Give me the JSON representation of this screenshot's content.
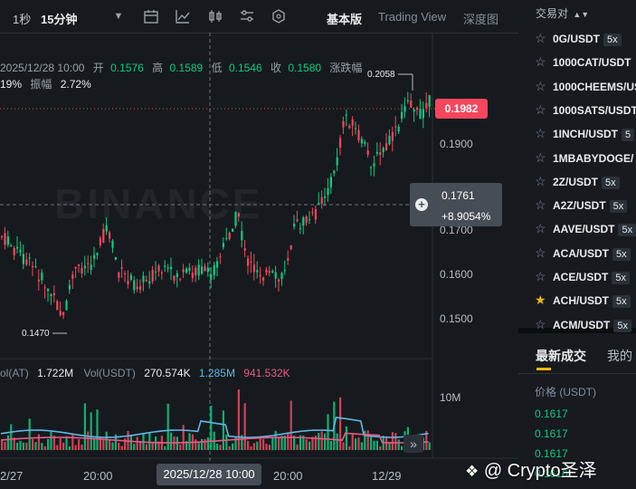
{
  "toolbar": {
    "intervals": [
      {
        "label": "1秒",
        "active": false
      },
      {
        "label": "15分钟",
        "active": true
      }
    ],
    "views": [
      {
        "label": "基本版",
        "active": true
      },
      {
        "label": "Trading View",
        "active": false
      },
      {
        "label": "深度图",
        "active": false
      }
    ]
  },
  "ohlc": {
    "datetime": "2025/12/28 10:00",
    "open_label": "开",
    "open": "0.1576",
    "high_label": "高",
    "high": "0.1589",
    "low_label": "低",
    "low": "0.1546",
    "close_label": "收",
    "close": "0.1580",
    "change_label": "涨跌幅",
    "change_pct": "19%",
    "amp_label": "振幅",
    "amp": "2.72%"
  },
  "price_axis": [
    "0.1900",
    "0.1700",
    "0.1600",
    "0.1500"
  ],
  "current_price": "0.1982",
  "crosshair": {
    "price": "0.1761",
    "change": "+8.9054%"
  },
  "high_marker": "0.2058",
  "low_marker": "0.1470",
  "watermark": "BINANCE",
  "volume": {
    "vol_at_label": "ol(AT)",
    "vol_at": "1.722M",
    "vol_usdt_label": "Vol(USDT)",
    "vol_usdt": "270.574K",
    "ma1": "1.285M",
    "ma2": "941.532K",
    "axis_label": "10M",
    "colors": {
      "ma1": "#5fb8e6",
      "ma2": "#e85a8a"
    }
  },
  "time_axis": {
    "labels": [
      "2/27",
      "20:00",
      "20:00",
      "12/29"
    ],
    "highlight": "2025/12/28 10:00"
  },
  "pairs": {
    "header": "交易对",
    "items": [
      {
        "symbol": "0G/USDT",
        "leverage": "5x",
        "fav": false
      },
      {
        "symbol": "1000CAT/USDT",
        "leverage": "",
        "fav": false
      },
      {
        "symbol": "1000CHEEMS/USDT",
        "leverage": "",
        "fav": false
      },
      {
        "symbol": "1000SATS/USDT",
        "leverage": "",
        "fav": false
      },
      {
        "symbol": "1INCH/USDT",
        "leverage": "5",
        "fav": false
      },
      {
        "symbol": "1MBABYDOGE/",
        "leverage": "",
        "fav": false
      },
      {
        "symbol": "2Z/USDT",
        "leverage": "5x",
        "fav": false
      },
      {
        "symbol": "A2Z/USDT",
        "leverage": "5x",
        "fav": false
      },
      {
        "symbol": "AAVE/USDT",
        "leverage": "5x",
        "fav": false
      },
      {
        "symbol": "ACA/USDT",
        "leverage": "5x",
        "fav": false
      },
      {
        "symbol": "ACE/USDT",
        "leverage": "5x",
        "fav": false
      },
      {
        "symbol": "ACH/USDT",
        "leverage": "5x",
        "fav": true
      },
      {
        "symbol": "ACM/USDT",
        "leverage": "5x",
        "fav": false
      }
    ]
  },
  "trades": {
    "tab_active": "最新成交",
    "tab_inactive": "我的",
    "price_col": "价格 (USDT)",
    "prices": [
      "0.1617",
      "0.1617",
      "0.1617",
      "0.1616"
    ]
  },
  "credit": "@ Crypto圣泽",
  "colors": {
    "up": "#0ecb81",
    "down": "#f6465d",
    "accent": "#f0b90b"
  }
}
